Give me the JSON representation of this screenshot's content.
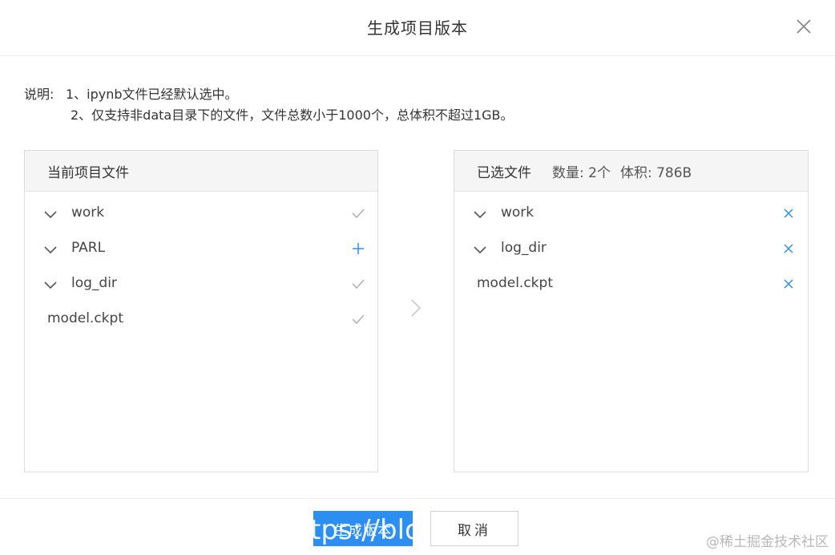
{
  "dialog": {
    "title": "生成项目版本"
  },
  "note": {
    "label": "说明:",
    "line1": "1、ipynb文件已经默认选中。",
    "line2": "2、仅支持非data目录下的文件，文件总数小于1000个，总体积不超过1GB。"
  },
  "current_panel": {
    "title": "当前项目文件",
    "items": [
      {
        "name": "work",
        "expandable": true,
        "action": "check"
      },
      {
        "name": "PARL",
        "expandable": true,
        "action": "add"
      },
      {
        "name": "log_dir",
        "expandable": true,
        "action": "check"
      },
      {
        "name": "model.ckpt",
        "expandable": false,
        "action": "check"
      }
    ]
  },
  "selected_panel": {
    "title": "已选文件",
    "count_text": "数量: 2个",
    "size_text": "体积: 786B",
    "items": [
      {
        "name": "work",
        "expandable": true,
        "action": "remove"
      },
      {
        "name": "log_dir",
        "expandable": true,
        "action": "remove"
      },
      {
        "name": "model.ckpt",
        "expandable": false,
        "action": "remove"
      }
    ]
  },
  "footer": {
    "confirm_label": "生成版本",
    "confirm_overlay": "tps://blo",
    "cancel_label": "取消"
  },
  "watermark": "@稀土掘金技术社区",
  "colors": {
    "accent": "#2b8ef0",
    "check": "#b0b0b0",
    "panel_head": "#f5f5f5"
  },
  "icons": {
    "close": "close-icon",
    "expand": "chevron-down-icon",
    "check": "check-icon",
    "add": "plus-icon",
    "remove": "remove-icon",
    "transfer": "chevron-right-icon"
  }
}
